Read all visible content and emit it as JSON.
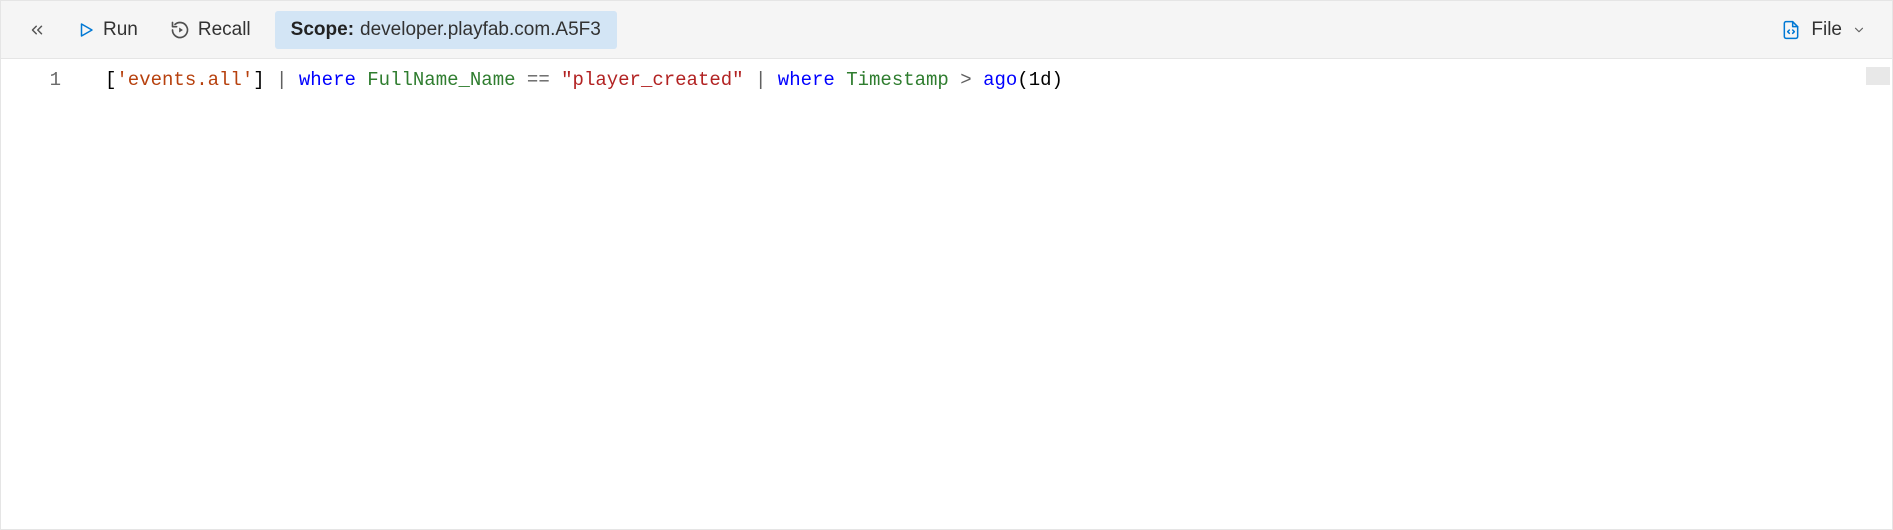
{
  "toolbar": {
    "run_label": "Run",
    "recall_label": "Recall",
    "scope_label": "Scope:",
    "scope_value": "developer.playfab.com.A5F3",
    "file_label": "File"
  },
  "editor": {
    "line_number": "1",
    "tokens": {
      "t1": "[",
      "t2": "'events.all'",
      "t3": "]",
      "t4": " ",
      "t5": "|",
      "t6": " ",
      "t7": "where",
      "t8": " ",
      "t9": "FullName_Name",
      "t10": " ",
      "t11": "==",
      "t12": " ",
      "t13": "\"player_created\"",
      "t14": " ",
      "t15": "|",
      "t16": " ",
      "t17": "where",
      "t18": " ",
      "t19": "Timestamp",
      "t20": " ",
      "t21": ">",
      "t22": " ",
      "t23": "ago",
      "t24": "(",
      "t25": "1d",
      "t26": ")"
    }
  }
}
